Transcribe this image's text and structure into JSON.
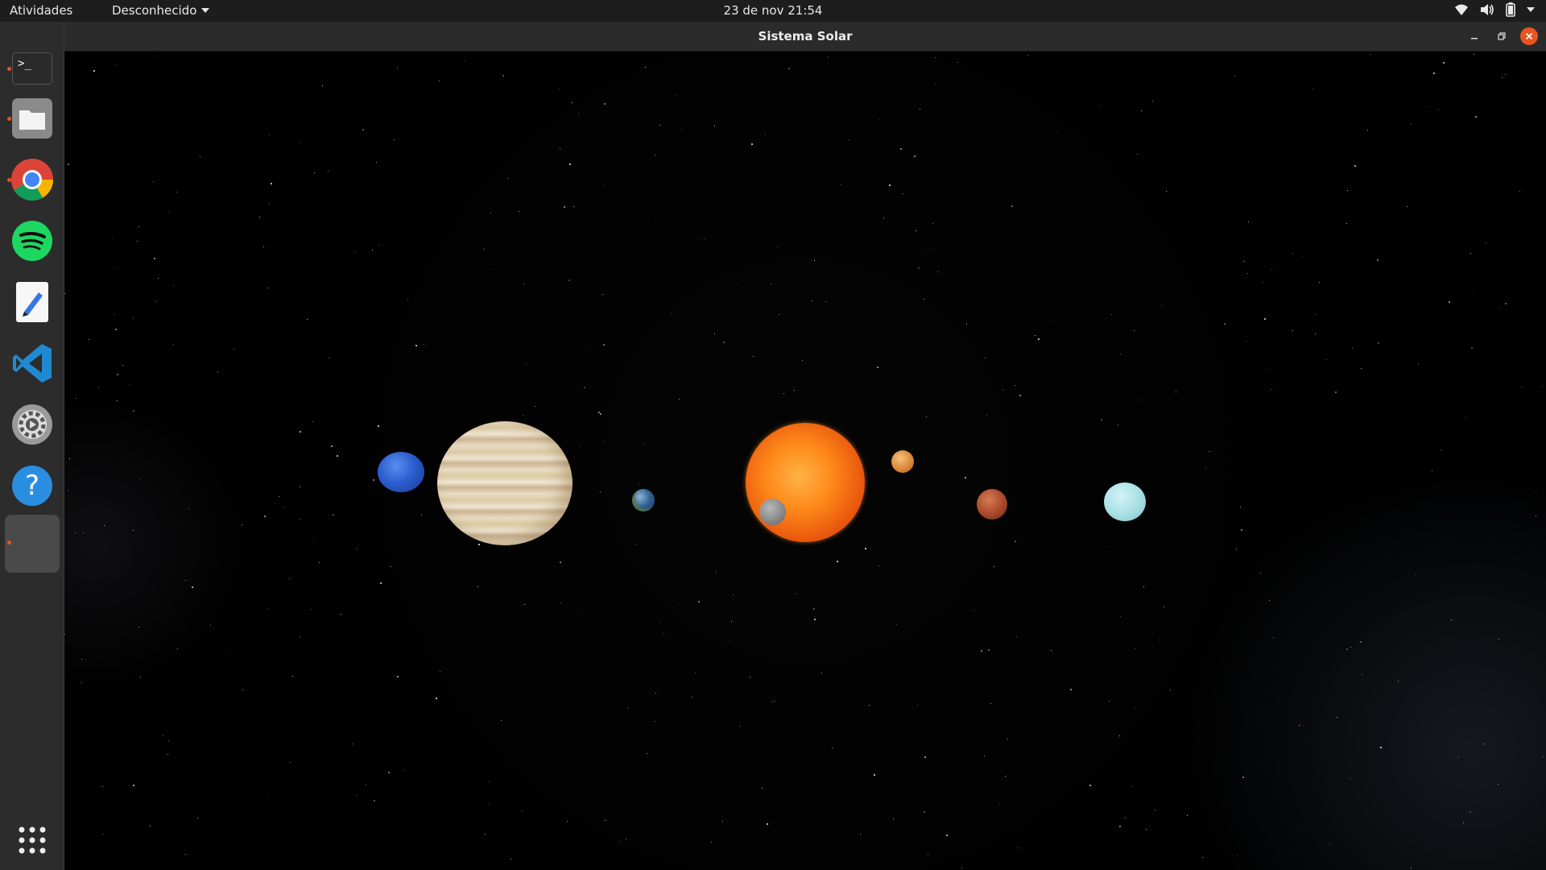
{
  "topbar": {
    "activities": "Atividades",
    "app_menu": "Desconhecido",
    "clock": "23 de nov  21:54"
  },
  "window": {
    "title": "Sistema Solar"
  },
  "dock": {
    "items": [
      {
        "name": "terminal",
        "glyph": ">_",
        "running": true
      },
      {
        "name": "files",
        "running": true
      },
      {
        "name": "chrome",
        "running": true
      },
      {
        "name": "spotify",
        "running": false
      },
      {
        "name": "text-editor",
        "running": false
      },
      {
        "name": "vscode",
        "running": false
      },
      {
        "name": "settings",
        "running": false
      },
      {
        "name": "help",
        "glyph": "?",
        "running": false
      },
      {
        "name": "current-app",
        "running": true
      }
    ]
  },
  "colors": {
    "accent": "#e95420",
    "topbar": "#1d1d1d",
    "dock": "#2c2c2c",
    "titlebar": "#2b2b2b"
  },
  "scene": {
    "bodies": [
      "sun",
      "mercury",
      "venus",
      "earth",
      "mars",
      "jupiter",
      "uranus",
      "neptune"
    ]
  }
}
